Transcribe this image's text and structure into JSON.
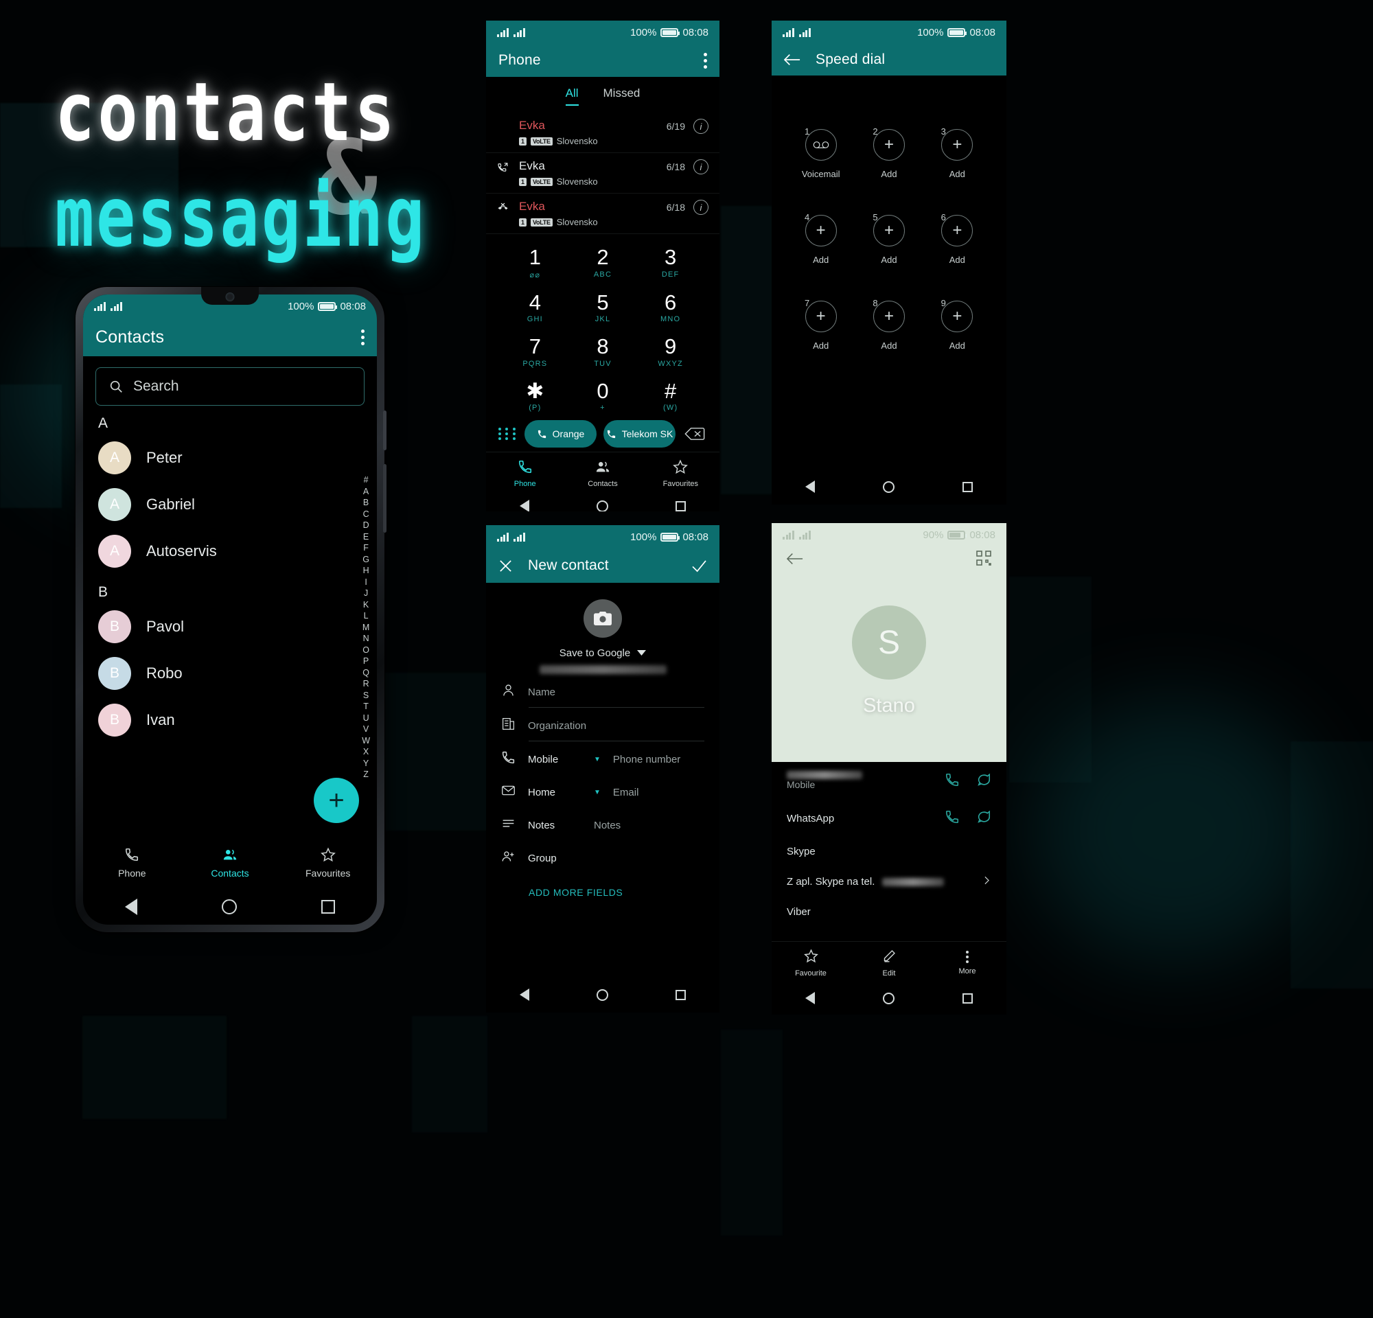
{
  "hero": {
    "line1": "contacts",
    "amp": "&",
    "line2": "messaging"
  },
  "theme": {
    "accent": "#0c6e6e",
    "accent_bright": "#2fe3e3",
    "missed": "#e0575c"
  },
  "status": {
    "battery": "100%",
    "time": "08:08",
    "battery_detail_screen": "90%"
  },
  "contacts_screen": {
    "title": "Contacts",
    "search_placeholder": "Search",
    "sections": [
      {
        "letter": "A",
        "items": [
          {
            "name": "Peter",
            "initial": "A",
            "color": "#e8dcc4"
          },
          {
            "name": "Gabriel",
            "initial": "A",
            "color": "#cfe4de"
          },
          {
            "name": "Autoservis",
            "initial": "A",
            "color": "#f0d7de"
          }
        ]
      },
      {
        "letter": "B",
        "items": [
          {
            "name": "Pavol",
            "initial": "B",
            "color": "#e6cdd6"
          },
          {
            "name": "Robo",
            "initial": "B",
            "color": "#c6dbe6"
          },
          {
            "name": "Ivan",
            "initial": "B",
            "color": "#f0d2d8"
          }
        ]
      }
    ],
    "alpha_index": [
      "#",
      "A",
      "B",
      "C",
      "D",
      "E",
      "F",
      "G",
      "H",
      "I",
      "J",
      "K",
      "L",
      "M",
      "N",
      "O",
      "P",
      "Q",
      "R",
      "S",
      "T",
      "U",
      "V",
      "W",
      "X",
      "Y",
      "Z"
    ],
    "fab_label": "+",
    "nav": [
      {
        "label": "Phone",
        "icon": "phone-icon",
        "active": false
      },
      {
        "label": "Contacts",
        "icon": "contacts-icon",
        "active": true
      },
      {
        "label": "Favourites",
        "icon": "star-icon",
        "active": false
      }
    ]
  },
  "phone_screen": {
    "title": "Phone",
    "tabs": [
      {
        "label": "All",
        "active": true
      },
      {
        "label": "Missed",
        "active": false
      }
    ],
    "calls": [
      {
        "name": "Evka",
        "missed": true,
        "type": "missed-call-icon",
        "sim": "1",
        "volte": "VoLTE",
        "network": "Slovensko",
        "date": "6/19"
      },
      {
        "name": "Evka",
        "missed": false,
        "type": "outgoing-call-icon",
        "sim": "1",
        "volte": "VoLTE",
        "network": "Slovensko",
        "date": "6/18"
      },
      {
        "name": "Evka",
        "missed": true,
        "type": "rejected-call-icon",
        "sim": "1",
        "volte": "VoLTE",
        "network": "Slovensko",
        "date": "6/18"
      }
    ],
    "keys": [
      {
        "digit": "1",
        "sub": "⌀⌀"
      },
      {
        "digit": "2",
        "sub": "ABC"
      },
      {
        "digit": "3",
        "sub": "DEF"
      },
      {
        "digit": "4",
        "sub": "GHI"
      },
      {
        "digit": "5",
        "sub": "JKL"
      },
      {
        "digit": "6",
        "sub": "MNO"
      },
      {
        "digit": "7",
        "sub": "PQRS"
      },
      {
        "digit": "8",
        "sub": "TUV"
      },
      {
        "digit": "9",
        "sub": "WXYZ"
      },
      {
        "digit": "✱",
        "sub": "(P)"
      },
      {
        "digit": "0",
        "sub": "+"
      },
      {
        "digit": "#",
        "sub": "(W)"
      }
    ],
    "call_buttons": [
      {
        "label": "Orange",
        "sim": "1"
      },
      {
        "label": "Telekom SK",
        "sim": "2"
      }
    ],
    "nav": [
      {
        "label": "Phone",
        "icon": "phone-icon",
        "active": true
      },
      {
        "label": "Contacts",
        "icon": "contacts-icon",
        "active": false
      },
      {
        "label": "Favourites",
        "icon": "star-icon",
        "active": false
      }
    ]
  },
  "speed_dial_screen": {
    "title": "Speed dial",
    "slots": [
      {
        "num": "1",
        "label": "Voicemail",
        "icon": "voicemail-icon"
      },
      {
        "num": "2",
        "label": "Add",
        "icon": "plus-icon"
      },
      {
        "num": "3",
        "label": "Add",
        "icon": "plus-icon"
      },
      {
        "num": "4",
        "label": "Add",
        "icon": "plus-icon"
      },
      {
        "num": "5",
        "label": "Add",
        "icon": "plus-icon"
      },
      {
        "num": "6",
        "label": "Add",
        "icon": "plus-icon"
      },
      {
        "num": "7",
        "label": "Add",
        "icon": "plus-icon"
      },
      {
        "num": "8",
        "label": "Add",
        "icon": "plus-icon"
      },
      {
        "num": "9",
        "label": "Add",
        "icon": "plus-icon"
      }
    ]
  },
  "new_contact_screen": {
    "title": "New contact",
    "save_account": "Save to Google",
    "fields": [
      {
        "icon": "person-icon",
        "label": "",
        "placeholder": "Name",
        "dropdown": false
      },
      {
        "icon": "organization-icon",
        "label": "",
        "placeholder": "Organization",
        "dropdown": false
      },
      {
        "icon": "phone-icon",
        "label": "Mobile",
        "placeholder": "Phone number",
        "dropdown": true
      },
      {
        "icon": "mail-icon",
        "label": "Home",
        "placeholder": "Email",
        "dropdown": true
      },
      {
        "icon": "notes-icon",
        "label": "Notes",
        "placeholder": "Notes",
        "dropdown": false
      },
      {
        "icon": "group-icon",
        "label": "Group",
        "placeholder": "",
        "dropdown": false
      }
    ],
    "add_more": "ADD MORE FIELDS"
  },
  "contact_detail_screen": {
    "name": "Stano",
    "avatar_initial": "S",
    "rows": [
      {
        "label": "",
        "sub": "Mobile",
        "redacted": true,
        "actions": [
          "call-icon",
          "message-icon"
        ]
      },
      {
        "label": "WhatsApp",
        "sub": "",
        "redacted": false,
        "actions": [
          "call-icon",
          "message-icon"
        ]
      },
      {
        "label": "Skype",
        "sub": "",
        "redacted": false,
        "actions": []
      },
      {
        "label": "Z apl. Skype na tel.",
        "sub": "",
        "redacted": true,
        "actions": [
          "chevron-right-icon"
        ]
      },
      {
        "label": "Viber",
        "sub": "",
        "redacted": false,
        "actions": []
      }
    ],
    "bottom": [
      {
        "label": "Favourite",
        "icon": "star-icon"
      },
      {
        "label": "Edit",
        "icon": "pencil-icon"
      },
      {
        "label": "More",
        "icon": "more-icon"
      }
    ]
  }
}
